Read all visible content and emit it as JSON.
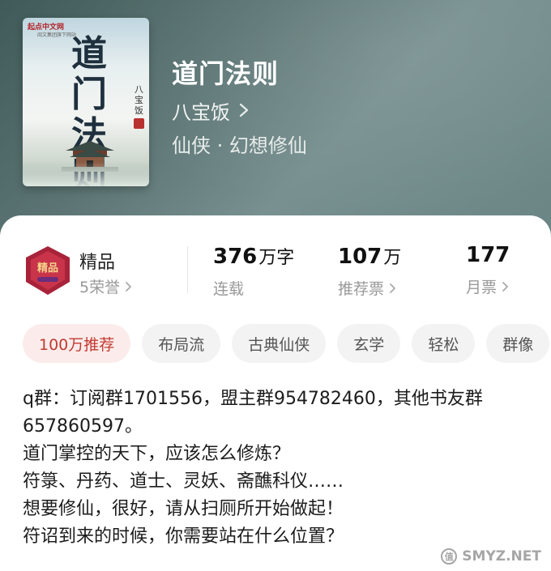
{
  "book": {
    "title": "道门法则",
    "author": "八宝饭",
    "genre": "仙侠 · 幻想修仙",
    "cover": {
      "publisher": "起点中文网",
      "publisher_sub": "阅文集团旗下网站",
      "title_line1": "道门",
      "title_line2": "法则",
      "author": "八宝饭"
    }
  },
  "stats": {
    "badge": {
      "title": "精品",
      "honors": "5荣誉",
      "icon": "premium-badge-icon",
      "badge_text": "精品"
    },
    "word_count": {
      "value": "376",
      "unit": "万字",
      "label": "连载"
    },
    "recommend": {
      "value": "107",
      "unit": "万",
      "label": "推荐票"
    },
    "monthly": {
      "value": "177",
      "unit": "",
      "label": "月票"
    }
  },
  "tags": [
    "100万推荐",
    "布局流",
    "古典仙侠",
    "玄学",
    "轻松",
    "群像"
  ],
  "description": [
    "q群：订阅群1701556，盟主群954782460，其他书友群657860597。",
    "道门掌控的天下，应该怎么修炼？",
    "符箓、丹药、道士、灵妖、斋醮科仪……",
    "想要修仙，很好，请从扫厕所开始做起！",
    "符诏到来的时候，你需要站在什么位置？"
  ],
  "watermark": {
    "icon": "值",
    "text": "SMYZ.NET"
  },
  "colors": {
    "header_bg": "#5d7675",
    "accent": "#c23a32",
    "badge_red": "#b32a3a"
  }
}
